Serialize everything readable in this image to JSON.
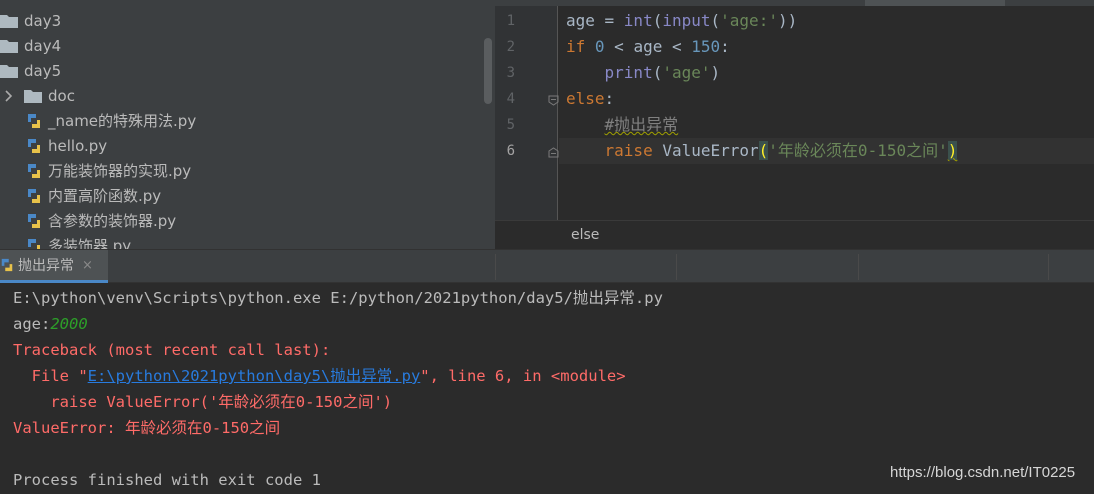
{
  "project_tree": {
    "items": [
      {
        "label": "day3",
        "kind": "folder"
      },
      {
        "label": "day4",
        "kind": "folder"
      },
      {
        "label": "day5",
        "kind": "folder"
      },
      {
        "label": "doc",
        "kind": "folder"
      },
      {
        "label": "_name的特殊用法.py",
        "kind": "python-file"
      },
      {
        "label": "hello.py",
        "kind": "python-file"
      },
      {
        "label": "万能装饰器的实现.py",
        "kind": "python-file"
      },
      {
        "label": "内置高阶函数.py",
        "kind": "python-file"
      },
      {
        "label": "含参数的装饰器.py",
        "kind": "python-file"
      },
      {
        "label": "多装饰器.py",
        "kind": "python-file"
      }
    ]
  },
  "editor": {
    "line_numbers": [
      "1",
      "2",
      "3",
      "4",
      "5",
      "6"
    ],
    "current_line": 6,
    "lines": {
      "l1": {
        "a": "age = ",
        "b": "int",
        "c": "(",
        "d": "input",
        "e": "(",
        "f": "'age:'",
        "g": "))"
      },
      "l2": {
        "a": "if ",
        "b": "0",
        "c": " < age < ",
        "d": "150",
        "e": ":"
      },
      "l3": {
        "a": "    ",
        "b": "print",
        "c": "(",
        "d": "'age'",
        "e": ")"
      },
      "l4": {
        "a": "else",
        "b": ":"
      },
      "l5": {
        "a": "    ",
        "b": "#抛出异常"
      },
      "l6": {
        "a": "    ",
        "b": "raise ",
        "c": "ValueError",
        "d": "(",
        "e": "'年龄必须在0-150之间'",
        "f": ")"
      }
    },
    "breadcrumb": "else"
  },
  "run_panel": {
    "tab_label": "抛出异常",
    "tab_close": "×"
  },
  "console": {
    "command": "E:\\python\\venv\\Scripts\\python.exe E:/python/2021python/day5/抛出异常.py",
    "prompt": "age:",
    "input_value": "2000",
    "traceback_header": "Traceback (most recent call last):",
    "file_prefix": "  File \"",
    "file_link": "E:\\python\\2021python\\day5\\抛出异常.py",
    "file_suffix": "\", line 6, in <module>",
    "source_line": "    raise ValueError('年龄必须在0-150之间')",
    "error_line": "ValueError: 年龄必须在0-150之间",
    "exit_line": "Process finished with exit code 1"
  },
  "watermark": "https://blog.csdn.net/IT0225",
  "colors": {
    "keyword": "#cc7832",
    "number": "#6897bb",
    "string": "#6a8759",
    "builtin": "#8888c6",
    "error": "#ff6b68",
    "link": "#287bde",
    "user_input": "#2d9f29"
  }
}
